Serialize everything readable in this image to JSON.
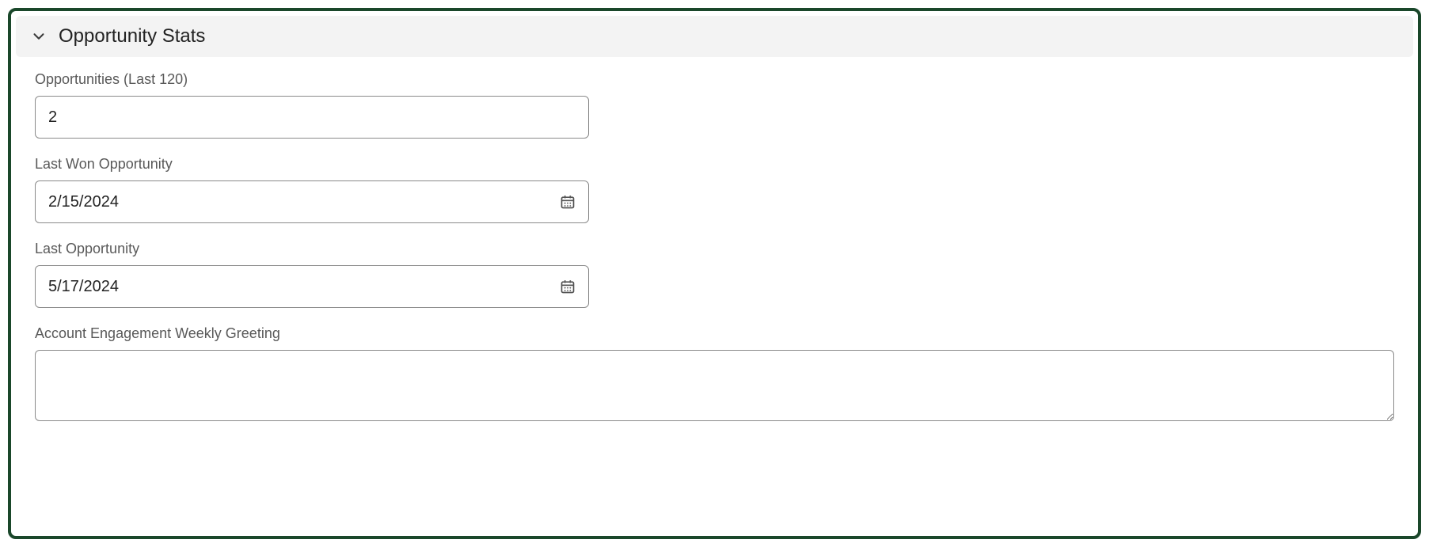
{
  "section": {
    "title": "Opportunity Stats"
  },
  "fields": {
    "opportunities": {
      "label": "Opportunities (Last 120)",
      "value": "2"
    },
    "lastWonOpportunity": {
      "label": "Last Won Opportunity",
      "value": "2/15/2024"
    },
    "lastOpportunity": {
      "label": "Last Opportunity",
      "value": "5/17/2024"
    },
    "greeting": {
      "label": "Account Engagement Weekly Greeting",
      "value": ""
    }
  }
}
